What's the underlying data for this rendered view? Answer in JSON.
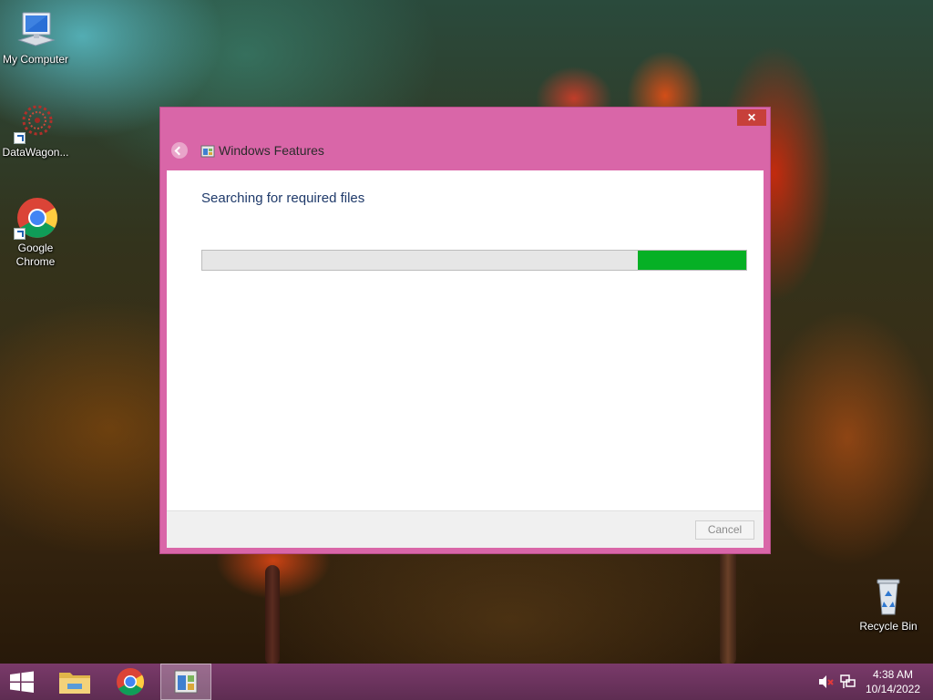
{
  "desktop": {
    "icons": [
      {
        "label": "My Computer",
        "icon": "computer-icon"
      },
      {
        "label": "DataWagon...",
        "icon": "datawagon-icon"
      },
      {
        "label": "Google\nChrome",
        "icon": "chrome-icon"
      },
      {
        "label": "Recycle Bin",
        "icon": "recycle-bin-icon"
      }
    ]
  },
  "dialog": {
    "title": "Windows Features",
    "close_label": "✕",
    "status_text": "Searching for required files",
    "progress": {
      "fill_start": 0.8,
      "fill_end": 1.0,
      "fill_color": "#06b025"
    },
    "cancel_label": "Cancel",
    "frame_color": "#d966a8"
  },
  "taskbar": {
    "color": "#6a3360",
    "items": [
      "start-button",
      "file-explorer",
      "google-chrome",
      "windows-features"
    ],
    "tray": {
      "volume": "muted",
      "network": "network-icon"
    },
    "clock": {
      "time": "4:38 AM",
      "date": "10/14/2022"
    }
  }
}
